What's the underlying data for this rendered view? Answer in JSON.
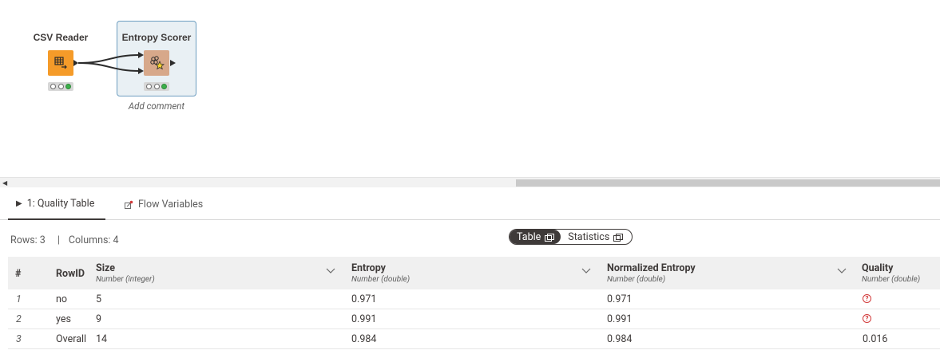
{
  "workflow": {
    "nodes": [
      {
        "name": "CSV Reader",
        "icon": "table-arrow-icon",
        "color": "#f59b29",
        "status": "executed"
      },
      {
        "name": "Entropy Scorer",
        "icon": "scorer-icon",
        "color": "#d7a88a",
        "status": "executed",
        "comment_placeholder": "Add comment"
      }
    ]
  },
  "tabs": [
    {
      "label": "1: Quality Table",
      "icon": "play-icon",
      "active": true
    },
    {
      "label": "Flow Variables",
      "icon": "flow-variable-icon",
      "active": false
    }
  ],
  "info": {
    "rows": "Rows: 3",
    "separator": "|",
    "columns": "Columns: 4"
  },
  "view_toggle": {
    "options": [
      "Table",
      "Statistics"
    ],
    "selected": "Table"
  },
  "table": {
    "index_header": "#",
    "rowid_header": "RowID",
    "columns": [
      {
        "name": "Size",
        "type": "Number (integer)"
      },
      {
        "name": "Entropy",
        "type": "Number (double)"
      },
      {
        "name": "Normalized Entropy",
        "type": "Number (double)"
      },
      {
        "name": "Quality",
        "type": "Number (double)"
      }
    ],
    "rows": [
      {
        "index": "1",
        "rowid": "no",
        "size": "5",
        "entropy": "0.971",
        "normalized": "0.971",
        "quality": "?",
        "quality_missing": true
      },
      {
        "index": "2",
        "rowid": "yes",
        "size": "9",
        "entropy": "0.991",
        "normalized": "0.991",
        "quality": "?",
        "quality_missing": true
      },
      {
        "index": "3",
        "rowid": "Overall",
        "size": "14",
        "entropy": "0.984",
        "normalized": "0.984",
        "quality": "0.016",
        "quality_missing": false
      }
    ]
  },
  "colors": {
    "csv_node": "#f59b29",
    "scorer_node": "#d7a88a",
    "selection_bg": "#e9f0f4",
    "selection_border": "#6e9ec0",
    "status_green": "#3cb04a",
    "missing_value": "#d23a3a"
  }
}
